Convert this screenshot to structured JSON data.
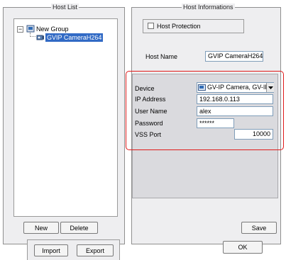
{
  "host_list": {
    "legend": "Host List",
    "tree": {
      "group_label": "New Group",
      "expander": "−",
      "camera_label": "GVIP CameraH264"
    },
    "buttons": {
      "new": "New",
      "delete": "Delete"
    }
  },
  "host_info": {
    "legend": "Host Informations",
    "host_protection_label": "Host Protection",
    "host_name_label": "Host Name",
    "host_name_value": "GVIP CameraH264",
    "device_label": "Device",
    "device_value": "GV-IP Camera, GV-IP Sp",
    "ip_address_label": "IP Address",
    "ip_address_value": "192.168.0.113",
    "user_name_label": "User Name",
    "user_name_value": "alex",
    "password_label": "Password",
    "password_value": "******",
    "vss_port_label": "VSS Port",
    "vss_port_value": "10000",
    "save": "Save"
  },
  "footer": {
    "import": "Import",
    "export": "Export",
    "ok": "OK"
  },
  "colors": {
    "highlight_border": "#e01a1a",
    "selection": "#316ac5"
  }
}
